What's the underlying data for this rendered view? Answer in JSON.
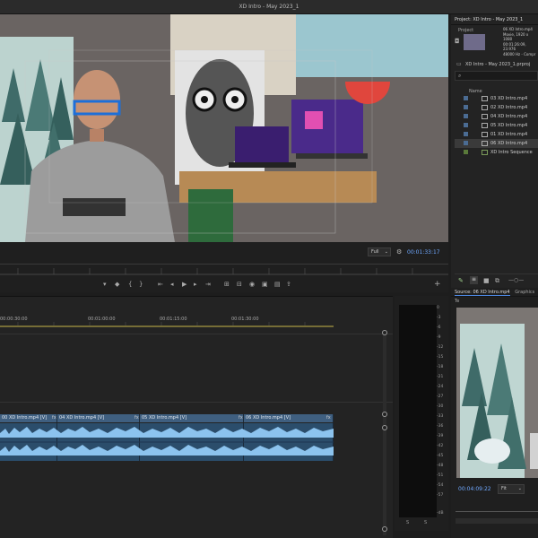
{
  "app": {
    "title": "XD Intro - May 2023_1"
  },
  "program": {
    "zoom": "Full",
    "timecode": "00:01:33:17"
  },
  "project": {
    "tab": "Project: XD Intro - May 2023_1",
    "tab2": "Project",
    "clip_meta": [
      "06 XD Intro.mp4",
      "Movie, 1920 x 1080",
      "00:01:26:09, 23.976",
      "48000 Hz - Compr"
    ],
    "project_file": "XD Intro - May 2023_1.prproj",
    "name_header": "Name",
    "items": [
      "03 XD Intro.mp4",
      "02 XD Intro.mp4",
      "04 XD Intro.mp4",
      "05 XD Intro.mp4",
      "01 XD Intro.mp4",
      "06 XD Intro.mp4",
      "XD Intro Sequence"
    ]
  },
  "timeline": {
    "timecodes": [
      "00:00:30:00",
      "00:01:00:00",
      "00:01:15:00",
      "00:01:30:00"
    ],
    "clips": [
      "00 XD Intro.mp4 [V]",
      "04 XD Intro.mp4 [V]",
      "05 XD Intro.mp4 [V]",
      "06 XD Intro.mp4 [V]"
    ],
    "fx": "fx"
  },
  "meter": {
    "labels": [
      "0",
      "-3",
      "-6",
      "-9",
      "-12",
      "-15",
      "-18",
      "-21",
      "-24",
      "-27",
      "-30",
      "-33",
      "-36",
      "-39",
      "-42",
      "-45",
      "-48",
      "-51",
      "-54",
      "-57",
      "-dB"
    ],
    "bottom": [
      "S",
      "S"
    ]
  },
  "source": {
    "tab": "Source: 06 XD Intro.mp4",
    "tab2": "Graphics Te",
    "timecode": "00:04:09:22",
    "zoom": "Fit"
  }
}
